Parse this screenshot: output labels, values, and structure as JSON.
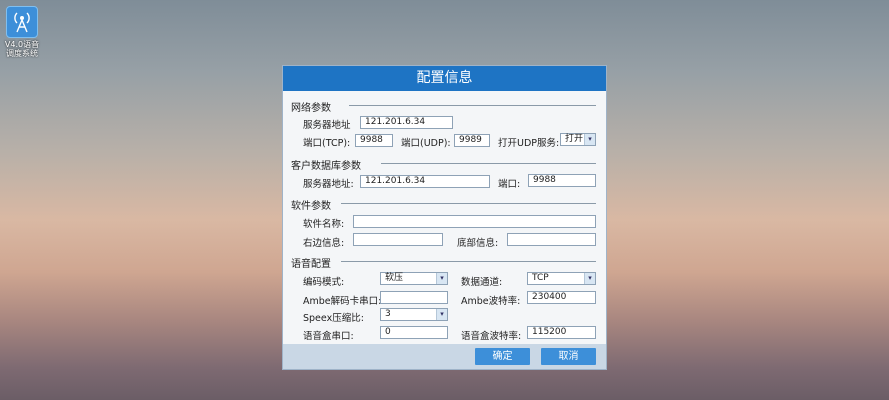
{
  "desktop": {
    "icon_label_line1": "V4.0语音",
    "icon_label_line2": "调度系统"
  },
  "dialog": {
    "title": "配置信息",
    "network": {
      "section": "网络参数",
      "server_addr_label": "服务器地址",
      "server_addr": "121.201.6.34",
      "tcp_label": "端口(TCP):",
      "tcp_port": "9988",
      "udp_label": "端口(UDP):",
      "udp_port": "9989",
      "udp_service_label": "打开UDP服务:",
      "udp_service": "打开"
    },
    "client_db": {
      "section": "客户数据库参数",
      "server_addr_label": "服务器地址:",
      "server_addr": "121.201.6.34",
      "port_label": "端口:",
      "port": "9988"
    },
    "software": {
      "section": "软件参数",
      "name_label": "软件名称:",
      "name": "",
      "right_label": "右边信息:",
      "right": "",
      "bottom_label": "底部信息:",
      "bottom": ""
    },
    "voice": {
      "section": "语音配置",
      "encode_label": "编码模式:",
      "encode": "软压",
      "channel_label": "数据通道:",
      "channel": "TCP",
      "ambe_port_label": "Ambe解码卡串口:",
      "ambe_port": "",
      "ambe_baud_label": "Ambe波特率:",
      "ambe_baud": "230400",
      "speex_label": "Speex压缩比:",
      "speex": "3",
      "box_port_label": "语音盒串口:",
      "box_port": "0",
      "box_baud_label": "语音盒波特率:",
      "box_baud": "115200"
    },
    "ok_label": "确定",
    "cancel_label": "取消"
  }
}
